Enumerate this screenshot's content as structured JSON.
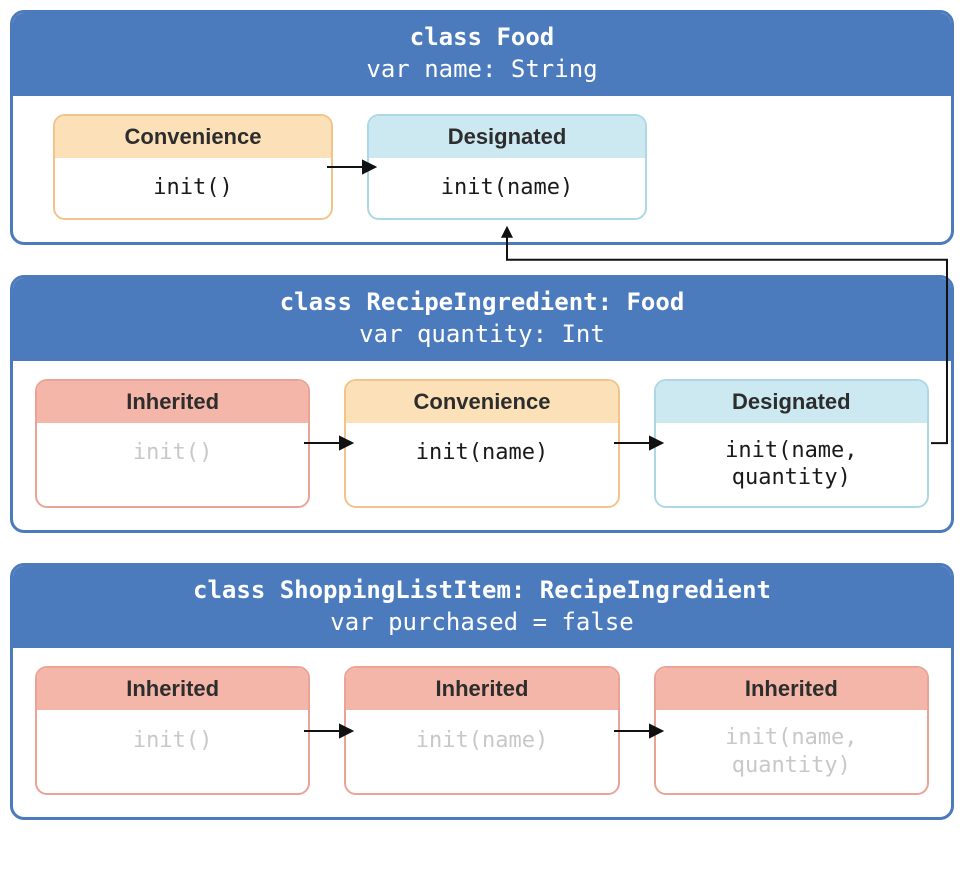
{
  "classes": [
    {
      "decl": "class Food",
      "var": "var name: String",
      "inits": [
        {
          "kind": "Convenience",
          "sig": "init()",
          "faded": false
        },
        {
          "kind": "Designated",
          "sig": "init(name)",
          "faded": false
        }
      ]
    },
    {
      "decl": "class RecipeIngredient: Food",
      "var": "var quantity: Int",
      "inits": [
        {
          "kind": "Inherited",
          "sig": "init()",
          "faded": true
        },
        {
          "kind": "Convenience",
          "sig": "init(name)",
          "faded": false
        },
        {
          "kind": "Designated",
          "sig": "init(name,\nquantity)",
          "faded": false
        }
      ]
    },
    {
      "decl": "class ShoppingListItem: RecipeIngredient",
      "var": "var purchased = false",
      "inits": [
        {
          "kind": "Inherited",
          "sig": "init()",
          "faded": true
        },
        {
          "kind": "Inherited",
          "sig": "init(name)",
          "faded": true
        },
        {
          "kind": "Inherited",
          "sig": "init(name,\nquantity)",
          "faded": true
        }
      ]
    }
  ]
}
